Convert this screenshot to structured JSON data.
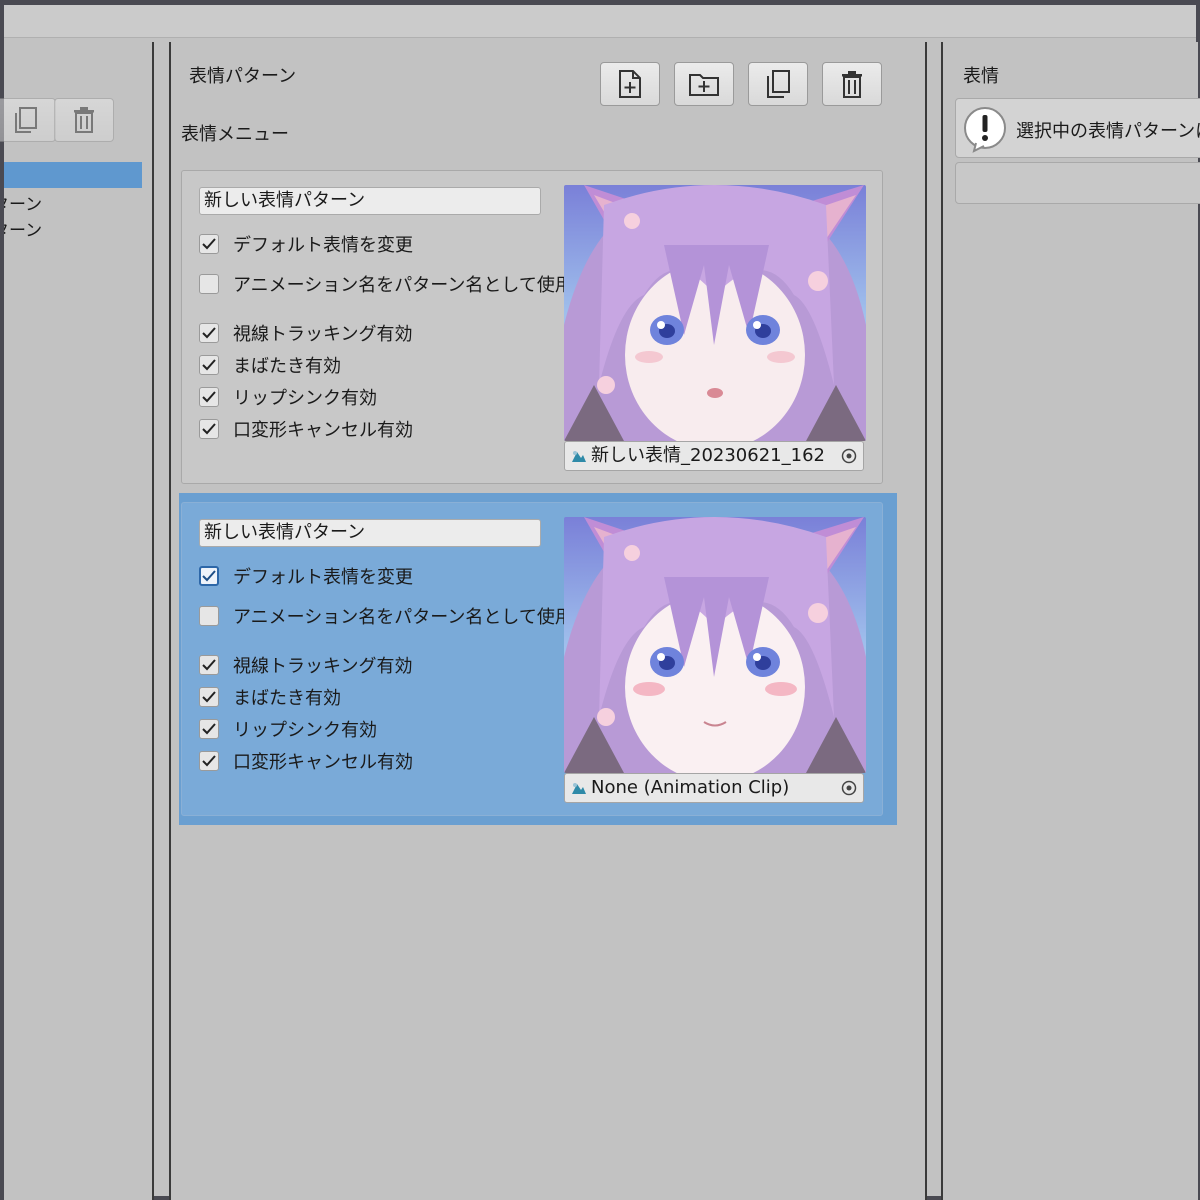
{
  "left_panel": {
    "items": [
      "新しい表情パターン",
      "新しい表情パターン"
    ]
  },
  "middle_panel": {
    "title": "表情パターン",
    "subtitle": "表情メニュー",
    "toolbar_icons": [
      "new-file-icon",
      "new-folder-icon",
      "duplicate-icon",
      "trash-icon"
    ],
    "patterns": [
      {
        "name": "新しい表情パターン",
        "checkboxes": [
          {
            "label": "デフォルト表情を変更",
            "checked": true
          },
          {
            "label": "アニメーション名をパターン名として使用",
            "checked": false
          },
          {
            "label": "視線トラッキング有効",
            "checked": true
          },
          {
            "label": "まばたき有効",
            "checked": true
          },
          {
            "label": "リップシンク有効",
            "checked": true
          },
          {
            "label": "口変形キャンセル有効",
            "checked": true
          }
        ],
        "clip": "新しい表情_20230621_162",
        "selected": false
      },
      {
        "name": "新しい表情パターン",
        "checkboxes": [
          {
            "label": "デフォルト表情を変更",
            "checked": true
          },
          {
            "label": "アニメーション名をパターン名として使用",
            "checked": false
          },
          {
            "label": "視線トラッキング有効",
            "checked": true
          },
          {
            "label": "まばたき有効",
            "checked": true
          },
          {
            "label": "リップシンク有効",
            "checked": true
          },
          {
            "label": "口変形キャンセル有効",
            "checked": true
          }
        ],
        "clip": "None (Animation Clip)",
        "selected": true
      }
    ]
  },
  "right_panel": {
    "title": "表情",
    "notice": "選択中の表情パターンに"
  },
  "colors": {
    "background": "#c2c2c2",
    "selection": "#6a9fd1",
    "card": "#c8c8c8"
  }
}
